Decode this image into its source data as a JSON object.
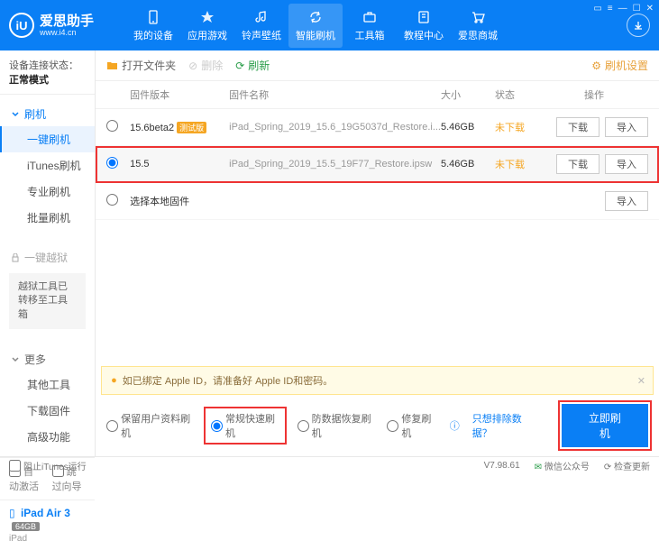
{
  "brand": {
    "name": "爱思助手",
    "url": "www.i4.cn",
    "logo_letter": "iU"
  },
  "nav": [
    {
      "label": "我的设备"
    },
    {
      "label": "应用游戏"
    },
    {
      "label": "铃声壁纸"
    },
    {
      "label": "智能刷机"
    },
    {
      "label": "工具箱"
    },
    {
      "label": "教程中心"
    },
    {
      "label": "爱思商城"
    }
  ],
  "conn": {
    "label": "设备连接状态：",
    "value": "正常模式"
  },
  "side": {
    "flash": {
      "hd": "刷机",
      "items": [
        "一键刷机",
        "iTunes刷机",
        "专业刷机",
        "批量刷机"
      ]
    },
    "jail": {
      "hd": "一键越狱",
      "note": "越狱工具已转移至工具箱"
    },
    "more": {
      "hd": "更多",
      "items": [
        "其他工具",
        "下载固件",
        "高级功能"
      ]
    }
  },
  "side_opts": {
    "auto": "自动激活",
    "skip": "跳过向导"
  },
  "device": {
    "name": "iPad Air 3",
    "storage": "64GB",
    "type": "iPad"
  },
  "toolbar": {
    "open": "打开文件夹",
    "del": "删除",
    "refresh": "刷新",
    "settings": "刷机设置"
  },
  "cols": {
    "ver": "固件版本",
    "name": "固件名称",
    "size": "大小",
    "stat": "状态",
    "act": "操作"
  },
  "rows": [
    {
      "ver": "15.6beta2",
      "badge": "测试版",
      "name": "iPad_Spring_2019_15.6_19G5037d_Restore.i...",
      "size": "5.46GB",
      "stat": "未下载",
      "dl": "下载",
      "imp": "导入",
      "sel": false
    },
    {
      "ver": "15.5",
      "badge": "",
      "name": "iPad_Spring_2019_15.5_19F77_Restore.ipsw",
      "size": "5.46GB",
      "stat": "未下载",
      "dl": "下载",
      "imp": "导入",
      "sel": true
    }
  ],
  "local_row": {
    "label": "选择本地固件",
    "imp": "导入"
  },
  "warn": "如已绑定 Apple ID，请准备好 Apple ID和密码。",
  "modes": {
    "keep": "保留用户资料刷机",
    "normal": "常规快速刷机",
    "protect": "防数据恢复刷机",
    "repair": "修复刷机"
  },
  "exclude_link": "只想排除数据？",
  "go_btn": "立即刷机",
  "footer": {
    "block": "阻止iTunes运行",
    "ver": "V7.98.61",
    "wechat": "微信公众号",
    "update": "检查更新"
  }
}
